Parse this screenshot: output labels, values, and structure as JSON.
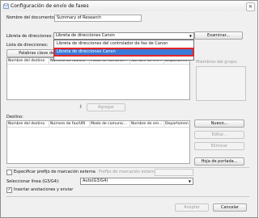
{
  "window": {
    "title": "Configuración de envío de faxes",
    "close_glyph": "✕"
  },
  "doc_name": {
    "label": "Nombre del documento:",
    "value": "Summary of Research"
  },
  "addressbook": {
    "label": "Libreta de direcciones:",
    "selected": "Libreta de direcciones Canon",
    "examine_button": "Examinar...",
    "options": [
      "Libreta de direcciones del controlador de fax de Canon",
      "Libreta de direcciones Canon"
    ]
  },
  "address_list": {
    "label": "Lista de direcciones:",
    "keyword_button": "Palabras clave de"
  },
  "columns": [
    "Nombre del destino",
    "Número de fax/URI",
    "Modo de comunic...",
    "Nombre de em...",
    "Departamento"
  ],
  "group_members": {
    "label": "Miembros del grupo:"
  },
  "add_button": "Agregar",
  "destination": {
    "label": "Destino:",
    "new_button": "Nuevo...",
    "edit_button": "Editar...",
    "delete_button": "Eliminar",
    "cover_button": "Hoja de portada..."
  },
  "prefix": {
    "checkbox_label": "Especificar prefijo de marcación externa",
    "field_label": "Prefijo de marcación externa:"
  },
  "line": {
    "label": "Seleccionar línea (G3/G4):",
    "value": "Auto(G3/G4)"
  },
  "annotations": {
    "label": "Insertar anotaciones y enviar",
    "checked": true
  },
  "footer": {
    "accept_button": "Aceptar",
    "cancel_button": "Cancelar"
  }
}
